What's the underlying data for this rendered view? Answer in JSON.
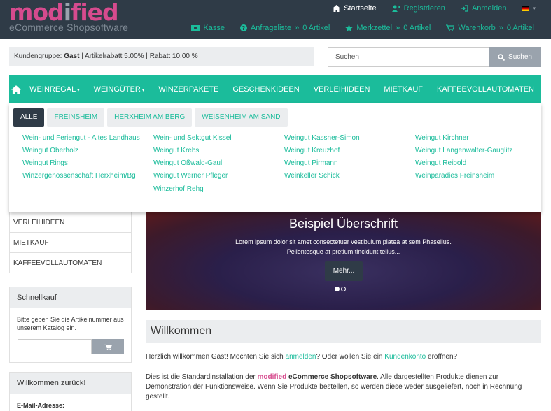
{
  "header": {
    "logo_main": "modified",
    "logo_sub": "eCommerce Shopsoftware",
    "top_links": [
      "Startseite",
      "Registrieren",
      "Anmelden"
    ],
    "lang_caret": "▾",
    "kasse": "Kasse",
    "anfrageliste": "Anfrageliste",
    "merkzettel": "Merkzettel",
    "warenkorb": "Warenkorb",
    "count_sep": "»",
    "count_text": "0 Artikel"
  },
  "customer": {
    "label": "Kundengruppe:",
    "group": "Gast",
    "rabatt_article": "Artikelrabatt 5.00%",
    "rabatt": "Rabatt 10.00 %"
  },
  "search": {
    "placeholder": "Suchen",
    "button": "Suchen"
  },
  "nav": {
    "items": [
      "WEINREGAL",
      "WEINGÜTER",
      "WINZERPAKETE",
      "GESCHENKIDEEN",
      "VERLEIHIDEEN",
      "MIETKAUF",
      "KAFFEEVOLLAUTOMATEN"
    ]
  },
  "mega": {
    "tabs": [
      "ALLE",
      "FREINSHEIM",
      "HERXHEIM AM BERG",
      "WEISENHEIM AM SAND"
    ],
    "links": [
      "Wein- und Feriengut - Altes Landhaus",
      "Wein- und Sektgut Kissel",
      "Weingut Kassner-Simon",
      "Weingut Kirchner",
      "Weingut Oberholz",
      "Weingut Krebs",
      "Weingut Kreuzhof",
      "Weingut Langenwalter-Gauglitz",
      "Weingut Rings",
      "Weingut Oßwald-Gaul",
      "Weingut Pirmann",
      "Weingut Reibold",
      "Winzergenossenschaft Herxheim/Bg",
      "Weingut Werner Pfleger",
      "Weinkeller Schick",
      "Weinparadies Freinsheim",
      "",
      "Winzerhof Rehg",
      "",
      ""
    ]
  },
  "sidebar": {
    "items": [
      "VERLEIHIDEEN",
      "MIETKAUF",
      "KAFFEEVOLLAUTOMATEN"
    ],
    "quick_title": "Schnellkauf",
    "quick_text": "Bitte geben Sie die Artikelnummer aus unserem Katalog ein.",
    "welcome_title": "Willkommen zurück!",
    "email_label": "E-Mail-Adresse:"
  },
  "banner": {
    "title": "Beispiel Überschrift",
    "text": "Lorem ipsum dolor sit amet consectetuer vestibulum platea at sem Phasellus. Pellentesque at pretium tincidunt tellus...",
    "button": "Mehr..."
  },
  "main": {
    "heading": "Willkommen",
    "p1_a": "Herzlich willkommen Gast! Möchten Sie sich ",
    "p1_link1": "anmelden",
    "p1_b": "? Oder wollen Sie ein ",
    "p1_link2": "Kundenkonto",
    "p1_c": " eröffnen?",
    "p2_a": "Dies ist die Standardinstallation der ",
    "p2_brand": "modified",
    "p2_b": " eCommerce Shopsoftware",
    "p2_c": ". Alle dargestellten Produkte dienen zur Demonstration der Funktionsweise. Wenn Sie Produkte bestellen, so werden diese weder ausgeliefert, noch in Rechnung gestellt."
  }
}
